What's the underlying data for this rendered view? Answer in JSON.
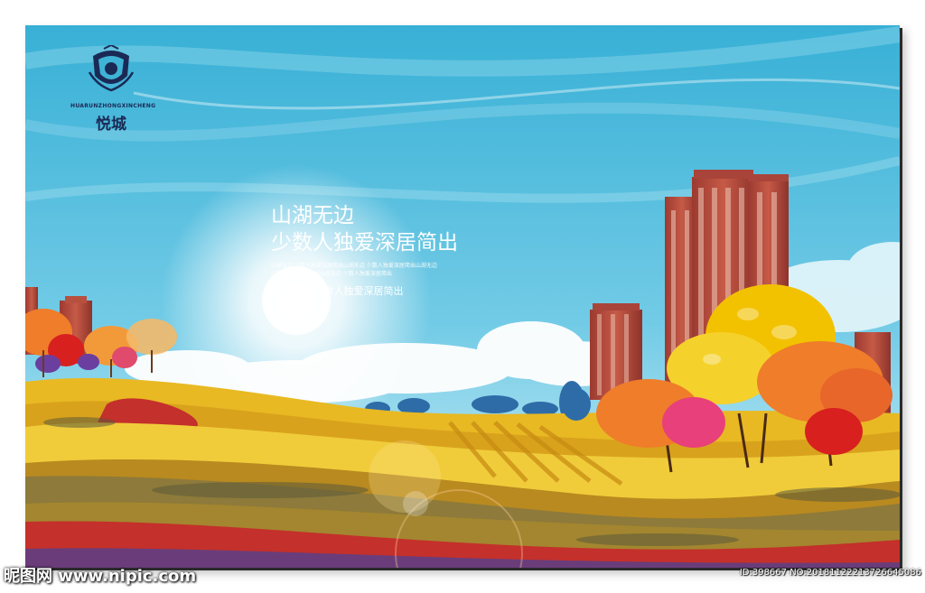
{
  "logo": {
    "brand_en": "HUARUNZHONGXINCHENG",
    "brand_cn": "悦城",
    "icon": "crest-icon"
  },
  "headline": {
    "line1": "山湖无边",
    "line2": "少数人独爱深居简出",
    "fine_print": "山湖无边 少数人独爱深居简出山湖无边 少数人独爱深居简出山湖无边 少数人独爱深居简出山湖无边 少数人独爱深居简出",
    "tagline": "山湖无边 少数人独爱深居简出"
  },
  "watermark": {
    "site": "昵图网 www.nipic.com",
    "id_text": "ID:398667 NO:20181122213726645086"
  },
  "colors": {
    "sky_top": "#3fb3d6",
    "sky_bottom": "#bfeaf6",
    "field_gold": "#e8b923",
    "field_red": "#c4302b",
    "building": "#b54a3c",
    "tree_yellow": "#f2c200",
    "tree_orange": "#ef7d2a"
  }
}
